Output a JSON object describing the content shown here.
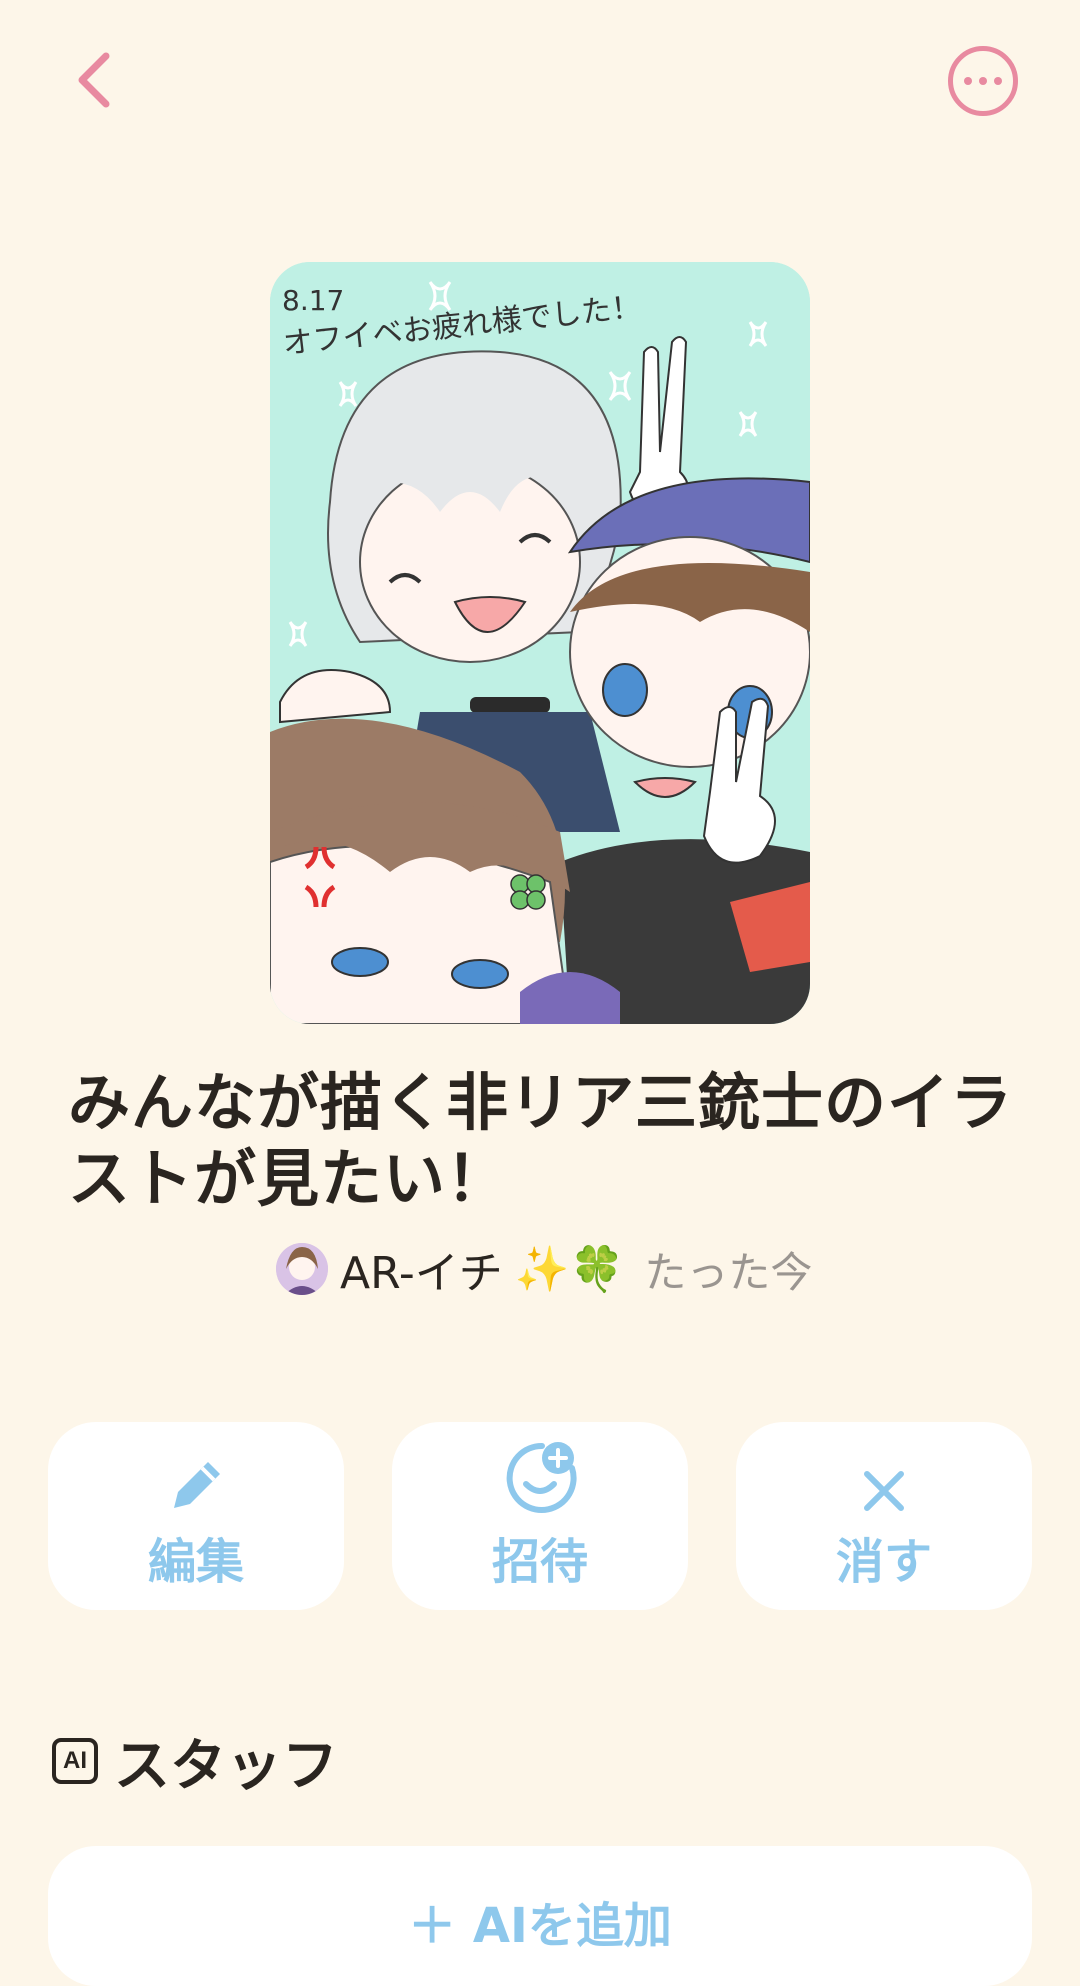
{
  "header": {
    "back_icon": "chevron-left-icon",
    "more_icon": "more-horizontal-icon",
    "accent_color": "#e88aa0"
  },
  "cover": {
    "caption_date": "8.17",
    "caption_text": "オフイベお疲れ様でした！"
  },
  "post": {
    "title": "みんなが描く非リア三銃士のイラストが見たい！",
    "author": "AR-イチ",
    "author_emoji": "✨🍀",
    "time": "たった今"
  },
  "actions": [
    {
      "label": "編集",
      "icon": "pencil-icon"
    },
    {
      "label": "招待",
      "icon": "invite-icon"
    },
    {
      "label": "消す",
      "icon": "close-icon"
    }
  ],
  "staff": {
    "badge": "AI",
    "title": "スタッフ",
    "add_label": "＋ AIを追加"
  },
  "colors": {
    "background": "#fdf6e9",
    "action_blue": "#8ec8ec",
    "text": "#2a2520"
  }
}
